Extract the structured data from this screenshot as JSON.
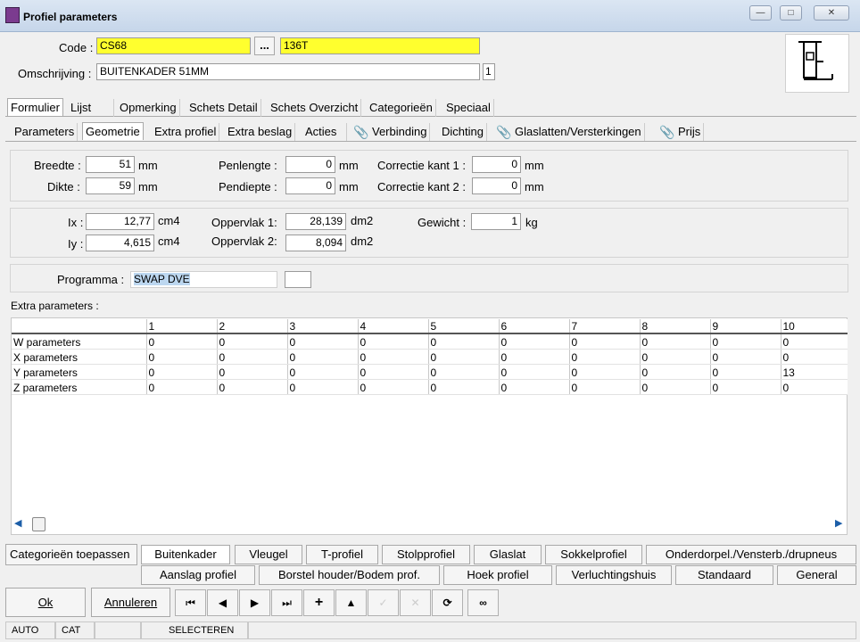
{
  "window": {
    "title": "Profiel parameters"
  },
  "code": {
    "label": "Code :",
    "value": "CS68",
    "browse": "...",
    "value2": "136T"
  },
  "omschrijving": {
    "label": "Omschrijving :",
    "value": "BUITENKADER 51MM",
    "count": "1"
  },
  "main_tabs": [
    "Formulier",
    "Lijst",
    "Opmerking",
    "Schets Detail",
    "Schets Overzicht",
    "Categorieën",
    "Speciaal"
  ],
  "sub_tabs": [
    "Parameters",
    "Geometrie",
    "Extra profiel",
    "Extra beslag",
    "Acties",
    "Verbinding",
    "Dichting",
    "Glaslatten/Versterkingen",
    "Prijs"
  ],
  "dims": {
    "breedte": {
      "label": "Breedte :",
      "value": "51",
      "unit": "mm"
    },
    "dikte": {
      "label": "Dikte :",
      "value": "59",
      "unit": "mm"
    },
    "penlengte": {
      "label": "Penlengte :",
      "value": "0",
      "unit": "mm"
    },
    "pendiepte": {
      "label": "Pendiepte :",
      "value": "0",
      "unit": "mm"
    },
    "correctie1": {
      "label": "Correctie kant 1 :",
      "value": "0",
      "unit": "mm"
    },
    "correctie2": {
      "label": "Correctie kant 2 :",
      "value": "0",
      "unit": "mm"
    }
  },
  "props": {
    "ix": {
      "label": "Ix :",
      "value": "12,77",
      "unit": "cm4"
    },
    "iy": {
      "label": "Iy :",
      "value": "4,615",
      "unit": "cm4"
    },
    "opp1": {
      "label": "Oppervlak 1:",
      "value": "28,139",
      "unit": "dm2"
    },
    "opp2": {
      "label": "Oppervlak 2:",
      "value": "8,094",
      "unit": "dm2"
    },
    "gewicht": {
      "label": "Gewicht :",
      "value": "1",
      "unit": "kg"
    }
  },
  "programma": {
    "label": "Programma :",
    "value": "SWAP DVE"
  },
  "extra": {
    "label": "Extra parameters :",
    "columns": [
      "1",
      "2",
      "3",
      "4",
      "5",
      "6",
      "7",
      "8",
      "9",
      "10"
    ],
    "rows": [
      {
        "name": "W parameters",
        "values": [
          "0",
          "0",
          "0",
          "0",
          "0",
          "0",
          "0",
          "0",
          "0",
          "0"
        ]
      },
      {
        "name": "X parameters",
        "values": [
          "0",
          "0",
          "0",
          "0",
          "0",
          "0",
          "0",
          "0",
          "0",
          "0"
        ]
      },
      {
        "name": "Y parameters",
        "values": [
          "0",
          "0",
          "0",
          "0",
          "0",
          "0",
          "0",
          "0",
          "0",
          "13"
        ]
      },
      {
        "name": "Z parameters",
        "values": [
          "0",
          "0",
          "0",
          "0",
          "0",
          "0",
          "0",
          "0",
          "0",
          "0"
        ]
      }
    ]
  },
  "categories": {
    "apply_label": "Categorieën toepassen",
    "row1": [
      "Buitenkader",
      "Vleugel",
      "T-profiel",
      "Stolpprofiel",
      "Glaslat",
      "Sokkelprofiel",
      "Onderdorpel./Vensterb./drupneus"
    ],
    "row2": [
      "Aanslag profiel",
      "Borstel houder/Bodem prof.",
      "Hoek profiel",
      "Verluchtingshuis",
      "Standaard",
      "General"
    ]
  },
  "actions": {
    "ok": "Ok",
    "cancel": "Annuleren"
  },
  "status": [
    "AUTO",
    "CAT",
    "",
    "SELECTEREN"
  ]
}
